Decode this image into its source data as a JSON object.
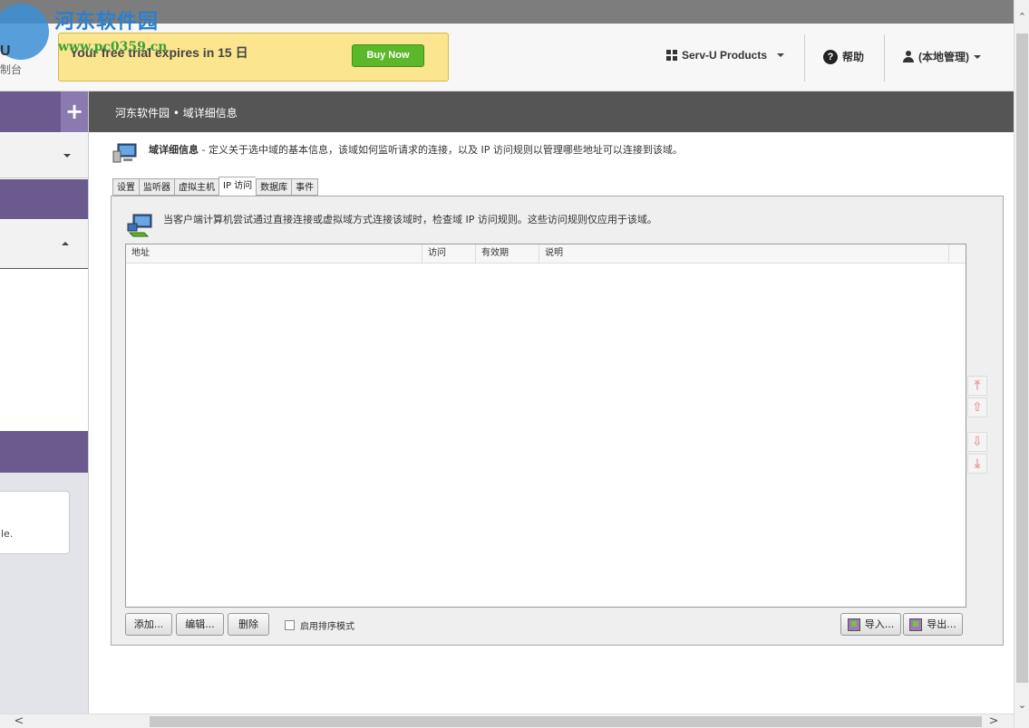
{
  "header": {
    "logo_letter": "U",
    "logo_sub": "制台",
    "watermark_title": "河东软件园",
    "watermark_url": "www.pc0359.cn",
    "trial_text": "Your free trial expires in 15 日",
    "buy_label": "Buy Now",
    "products_label": "Serv-U Products",
    "help_label": "帮助",
    "user_label": "(本地管理)"
  },
  "sidebar": {
    "card_text": "le."
  },
  "titlebar": {
    "text": "河东软件园 • 域详细信息"
  },
  "intro": {
    "title": "域详细信息",
    "text": " - 定义关于选中域的基本信息，该域如何监听请求的连接，以及 IP 访问规则以管理哪些地址可以连接到该域。"
  },
  "tabs": [
    "设置",
    "监听器",
    "虚拟主机",
    "IP 访问",
    "数据库",
    "事件"
  ],
  "active_tab": "IP 访问",
  "panel": {
    "description": "当客户端计算机尝试通过直接连接或虚拟域方式连接该域时，检查域 IP 访问规则。这些访问规则仅应用于该域。",
    "columns": [
      "地址",
      "访问",
      "有效期",
      "说明"
    ],
    "rows": []
  },
  "buttons": {
    "add": "添加...",
    "edit": "编辑...",
    "delete": "删除",
    "sort_mode": "启用排序模式",
    "import": "导入...",
    "export": "导出..."
  },
  "side_buttons": {
    "top": "⤒",
    "up": "⇧",
    "down": "⇩",
    "bottom": "⤓"
  },
  "scroll": {
    "up": "⌃",
    "down": "⌄",
    "left": "<",
    "right": ">"
  },
  "colors": {
    "purple": "#6b5a8e",
    "buy_green": "#5cb82a",
    "trial_yellow": "#fbe58f",
    "titlebar": "#555555"
  }
}
